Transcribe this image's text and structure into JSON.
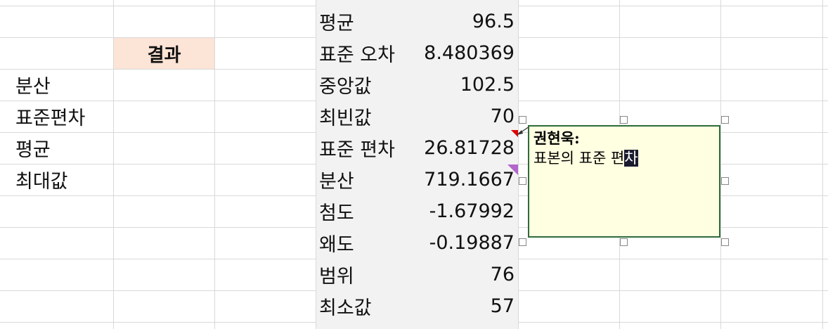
{
  "left_labels": [
    "분산",
    "표준편차",
    "평균",
    "최대값"
  ],
  "result_header": "결과",
  "stats": [
    {
      "label": "평균",
      "value": "96.5"
    },
    {
      "label": "표준 오차",
      "value": "8.480369"
    },
    {
      "label": "중앙값",
      "value": "102.5"
    },
    {
      "label": "최빈값",
      "value": "70"
    },
    {
      "label": "표준 편차",
      "value": "26.81728"
    },
    {
      "label": "분산",
      "value": "719.1667"
    },
    {
      "label": "첨도",
      "value": "-1.67992"
    },
    {
      "label": "왜도",
      "value": "-0.19887"
    },
    {
      "label": "범위",
      "value": "76"
    },
    {
      "label": "최소값",
      "value": "57"
    }
  ],
  "comment": {
    "author": "권현욱:",
    "text_before_selection": "표본의 표준 편",
    "selected_text": "차"
  },
  "colors": {
    "result_header_bg": "#fce4d6",
    "stats_panel_bg": "#f2f2f2",
    "comment_bg": "#ffffe1",
    "comment_border": "#2e6b3a",
    "comment_indicator": "#e00000",
    "error_indicator": "#b366cc"
  }
}
